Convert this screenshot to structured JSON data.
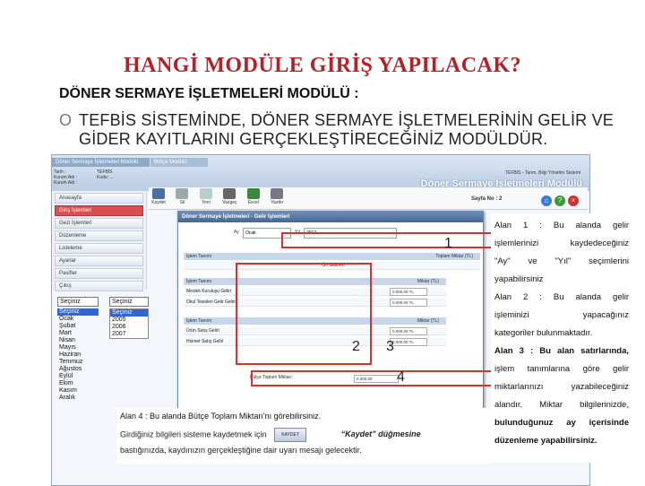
{
  "slide": {
    "title": "HANGİ MODÜLE GİRİŞ YAPILACAK?",
    "section_heading": "DÖNER SERMAYE İŞLETMELERİ MODÜLÜ :",
    "bullet_mark": "O",
    "bullet_text": "TEFBİS SİSTEMİNDE, DÖNER SERMAYE İŞLETMELERİNİN GELİR VE GİDER KAYITLARINI GERÇEKLEŞTİRECEĞİNİZ MODÜLDÜR."
  },
  "app": {
    "tabs": [
      "Döner Sermaye İşletmeleri Modülü",
      "Bütçe Modülü"
    ],
    "user_info": [
      "Tarih :",
      "Kurum Adı :",
      "Kurum Adı :"
    ],
    "user_info_values": [
      "",
      "TEFBİS",
      "Kodu: ..."
    ],
    "brand_subtitle": "TEFBİS - Tarım, Bilgi Yönetim Sistemi",
    "brand_title": "Döner Sermaye İşletmeleri Modülü",
    "menu": [
      "Anasayfa",
      "Giriş İşlemleri",
      "Gezi İşlemleri",
      "Düzenleme",
      "Listeleme",
      "Ayarlar",
      "Pasifler",
      "Çıkış"
    ],
    "active_menu": "Giriş İşlemleri",
    "toolbar": [
      "Kaydet",
      "Sil",
      "Yeni",
      "Vazgeç",
      "Excel",
      "Yazdır"
    ],
    "page_label": "Sayfa No : 2",
    "month_select": {
      "label": "Seçiniz",
      "options": [
        "Seçiniz",
        "Ocak",
        "Şubat",
        "Mart",
        "Nisan",
        "Mayıs",
        "Haziran",
        "Temmuz",
        "Ağustos",
        "Eylül",
        "Ekim",
        "Kasım",
        "Aralık"
      ],
      "selected": "Seçiniz"
    },
    "year_select": {
      "label": "Seçiniz",
      "options": [
        "Seçiniz",
        "2005",
        "2006",
        "2007"
      ],
      "selected": "Seçiniz"
    },
    "form": {
      "title": "Döner Sermaye İşletmeleri - Gelir İşlemleri",
      "month_label": "Ay",
      "month_value": "Ocak",
      "year_label": "Yıl",
      "year_value": "2012",
      "category_header_left": "İşlem Tanımı",
      "category_header_right": "Toplam Miktar (TL)",
      "category_value": "Ön Gelirleri",
      "section1_header": "İşlem Tanımı",
      "section1_amount_header": "Miktar (TL)",
      "rows1": [
        {
          "label": "Meslek Kuruluşu Geliri",
          "value": "0.000,00 TL"
        },
        {
          "label": "Okul Tesisleri Gelir Geliri",
          "value": "0.000,00 TL"
        }
      ],
      "section2_header": "İşlem Tanımı",
      "section2_amount_header": "Miktar (TL)",
      "rows2": [
        {
          "label": "Ürün Satış Geliri",
          "value": "0.000,00 TL"
        },
        {
          "label": "Hizmet Satış Geliri",
          "value": "0.000,00 TL"
        }
      ],
      "total_label": "Bütçe Toplam Miktarı:",
      "total_value": "0.000,00"
    },
    "zone_numbers": [
      "1",
      "2",
      "3",
      "4"
    ],
    "caption": {
      "line1": "Alan 4 : Bu alanda Bütçe Toplam Miktarı'nı görebilirsiniz.",
      "line2_pre": "Girdiğiniz bilgileri sisteme kaydetmek için",
      "kaydet_label": "KAYDET",
      "line2_post": "“Kaydet” düğmesine",
      "line3": "bastığınızda, kaydınızın gerçekleştiğine dair uyarı mesajı gelecektir."
    }
  },
  "explanations": [
    "Alan 1 : Bu alanda gelir",
    "işlemlerinizi kaydedeceğiniz",
    "\"Ay\" ve \"Yıl\" seçimlerini",
    "yapabilirsiniz",
    "Alan 2 : Bu alanda gelir",
    "işleminizi yapacağınız",
    "kategoriler bulunmaktadır.",
    "Alan 3 : Bu alan satırlarında,",
    "işlem tanımlarına göre gelir",
    "miktarlarınızı yazabileceğiniz",
    "alandır. Miktar bilgilerinizde,",
    "bulunduğunuz ay içerisinde",
    "düzenleme yapabilirsiniz."
  ],
  "colors": {
    "title": "#b0232a",
    "highlight": "#d93030",
    "active_menu": "#d94f4f",
    "accent_blue": "#3366cc"
  }
}
